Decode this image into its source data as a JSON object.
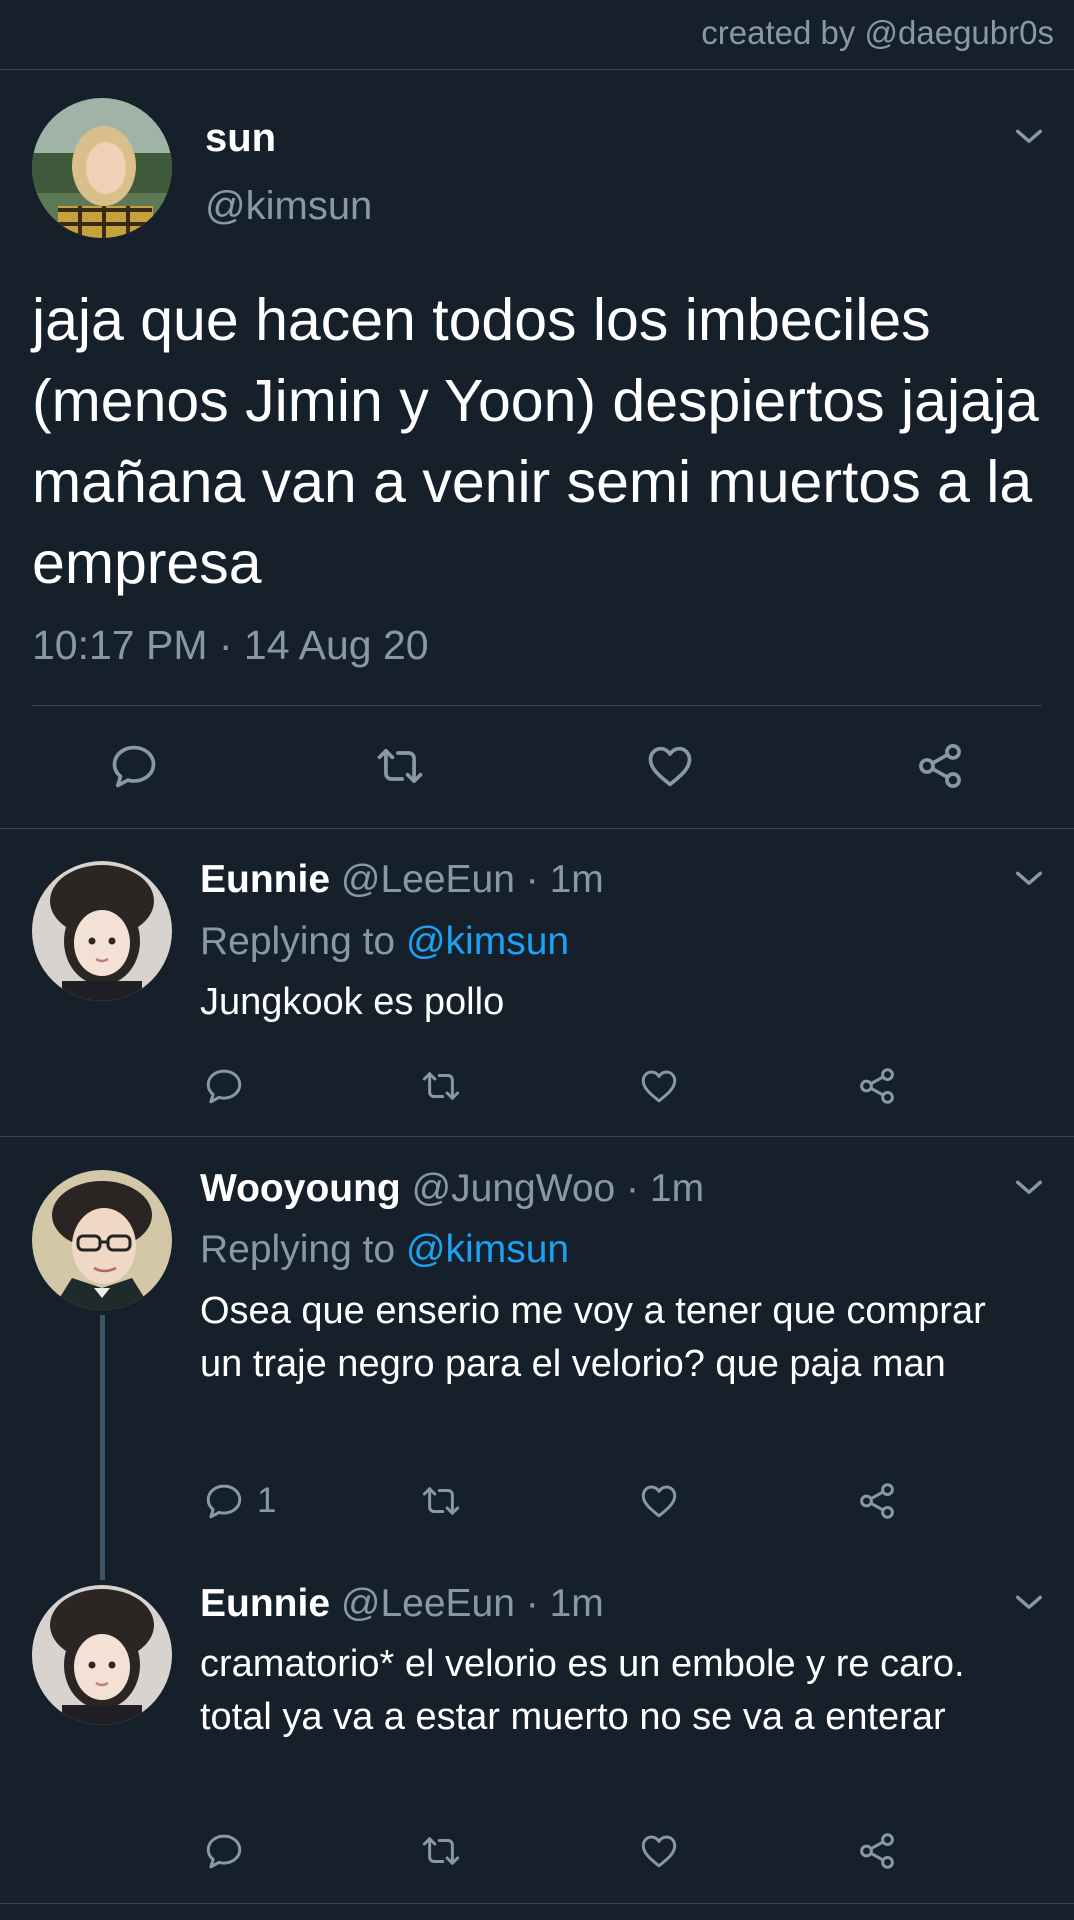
{
  "credit": "created by @daegubr0s",
  "main_tweet": {
    "name": "sun",
    "handle": "@kimsun",
    "avatar_icon": "avatar-blonde-girl",
    "text": "jaja que hacen todos los imbeciles (menos Jimin y Yoon)  despiertos jajaja mañana van a venir semi muertos a la empresa",
    "timestamp": "10:17 PM · 14 Aug 20"
  },
  "replies": [
    {
      "name": "Eunnie",
      "handle": "@LeeEun · 1m",
      "replying_prefix": "Replying to ",
      "replying_to": "@kimsun",
      "text": "Jungkook es pollo",
      "reply_count": ""
    },
    {
      "name": "Wooyoung",
      "handle": "@JungWoo · 1m",
      "replying_prefix": "Replying to ",
      "replying_to": "@kimsun",
      "text": "Osea que enserio me voy a tener que comprar un traje negro para el velorio? que paja man",
      "reply_count": "1"
    },
    {
      "name": "Eunnie",
      "handle": "@LeeEun · 1m",
      "text": "cramatorio* el velorio es un embole y re caro. total ya va a estar muerto no se va a enterar",
      "reply_count": ""
    }
  ],
  "colors": {
    "background": "#15202b",
    "secondary_text": "#8899a6",
    "link": "#1da1f2",
    "divider": "#38444d"
  },
  "icons": [
    "chevron-down-icon",
    "reply-icon",
    "retweet-icon",
    "like-icon",
    "share-icon"
  ]
}
